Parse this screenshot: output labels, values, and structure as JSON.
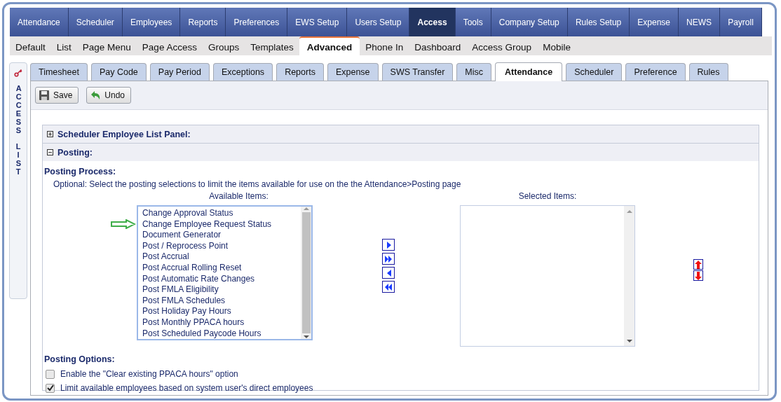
{
  "main_nav": [
    {
      "label": "Attendance",
      "selected": false
    },
    {
      "label": "Scheduler",
      "selected": false
    },
    {
      "label": "Employees",
      "selected": false
    },
    {
      "label": "Reports",
      "selected": false
    },
    {
      "label": "Preferences",
      "selected": false
    },
    {
      "label": "EWS Setup",
      "selected": false
    },
    {
      "label": "Users Setup",
      "selected": false
    },
    {
      "label": "Access",
      "selected": true
    },
    {
      "label": "Tools",
      "selected": false
    },
    {
      "label": "Company Setup",
      "selected": false
    },
    {
      "label": "Rules Setup",
      "selected": false
    },
    {
      "label": "Expense",
      "selected": false
    },
    {
      "label": "NEWS",
      "selected": false
    },
    {
      "label": "Payroll",
      "selected": false
    }
  ],
  "sub_nav": [
    {
      "label": "Default",
      "selected": false
    },
    {
      "label": "List",
      "selected": false
    },
    {
      "label": "Page Menu",
      "selected": false
    },
    {
      "label": "Page Access",
      "selected": false
    },
    {
      "label": "Groups",
      "selected": false
    },
    {
      "label": "Templates",
      "selected": false
    },
    {
      "label": "Advanced",
      "selected": true
    },
    {
      "label": "Phone In",
      "selected": false
    },
    {
      "label": "Dashboard",
      "selected": false
    },
    {
      "label": "Access Group",
      "selected": false
    },
    {
      "label": "Mobile",
      "selected": false
    }
  ],
  "side_panel": {
    "words": [
      "ACCESS",
      "LIST"
    ]
  },
  "tabs": [
    {
      "label": "Timesheet",
      "selected": false
    },
    {
      "label": "Pay Code",
      "selected": false
    },
    {
      "label": "Pay Period",
      "selected": false
    },
    {
      "label": "Exceptions",
      "selected": false
    },
    {
      "label": "Reports",
      "selected": false
    },
    {
      "label": "Expense",
      "selected": false
    },
    {
      "label": "SWS Transfer",
      "selected": false
    },
    {
      "label": "Misc",
      "selected": false
    },
    {
      "label": "Attendance",
      "selected": true
    },
    {
      "label": "Scheduler",
      "selected": false
    },
    {
      "label": "Preference",
      "selected": false
    },
    {
      "label": "Rules",
      "selected": false
    }
  ],
  "toolbar": [
    {
      "kind": "save",
      "label": "Save"
    },
    {
      "kind": "undo",
      "label": "Undo"
    }
  ],
  "sections": [
    {
      "title": "Scheduler Employee List Panel:",
      "expanded": false
    },
    {
      "title": "Posting:",
      "expanded": true
    }
  ],
  "posting_process": {
    "heading": "Posting Process:",
    "note": "Optional: Select the posting selections to limit the items available for use on the the Attendance>Posting page",
    "available_label": "Available Items:",
    "selected_label": "Selected Items:",
    "available_items": [
      {
        "label": "Change Approval Status",
        "pointed": false
      },
      {
        "label": "Change Employee Request Status",
        "pointed": true
      },
      {
        "label": "Document Generator",
        "pointed": false
      },
      {
        "label": "Post / Reprocess Point",
        "pointed": false
      },
      {
        "label": "Post Accrual",
        "pointed": false
      },
      {
        "label": "Post Accrual Rolling Reset",
        "pointed": false
      },
      {
        "label": "Post Automatic Rate Changes",
        "pointed": false
      },
      {
        "label": "Post FMLA Eligibility",
        "pointed": false
      },
      {
        "label": "Post FMLA Schedules",
        "pointed": false
      },
      {
        "label": "Post Holiday Pay Hours",
        "pointed": false
      },
      {
        "label": "Post Monthly PPACA hours",
        "pointed": false
      },
      {
        "label": "Post Scheduled Paycode Hours",
        "pointed": false
      }
    ]
  },
  "posting_options": {
    "heading": "Posting Options:",
    "options": [
      {
        "label": "Enable the \"Clear existing PPACA hours\" option",
        "checked": false
      },
      {
        "label": "Limit available employees based on system user's direct employees",
        "checked": true
      }
    ]
  }
}
